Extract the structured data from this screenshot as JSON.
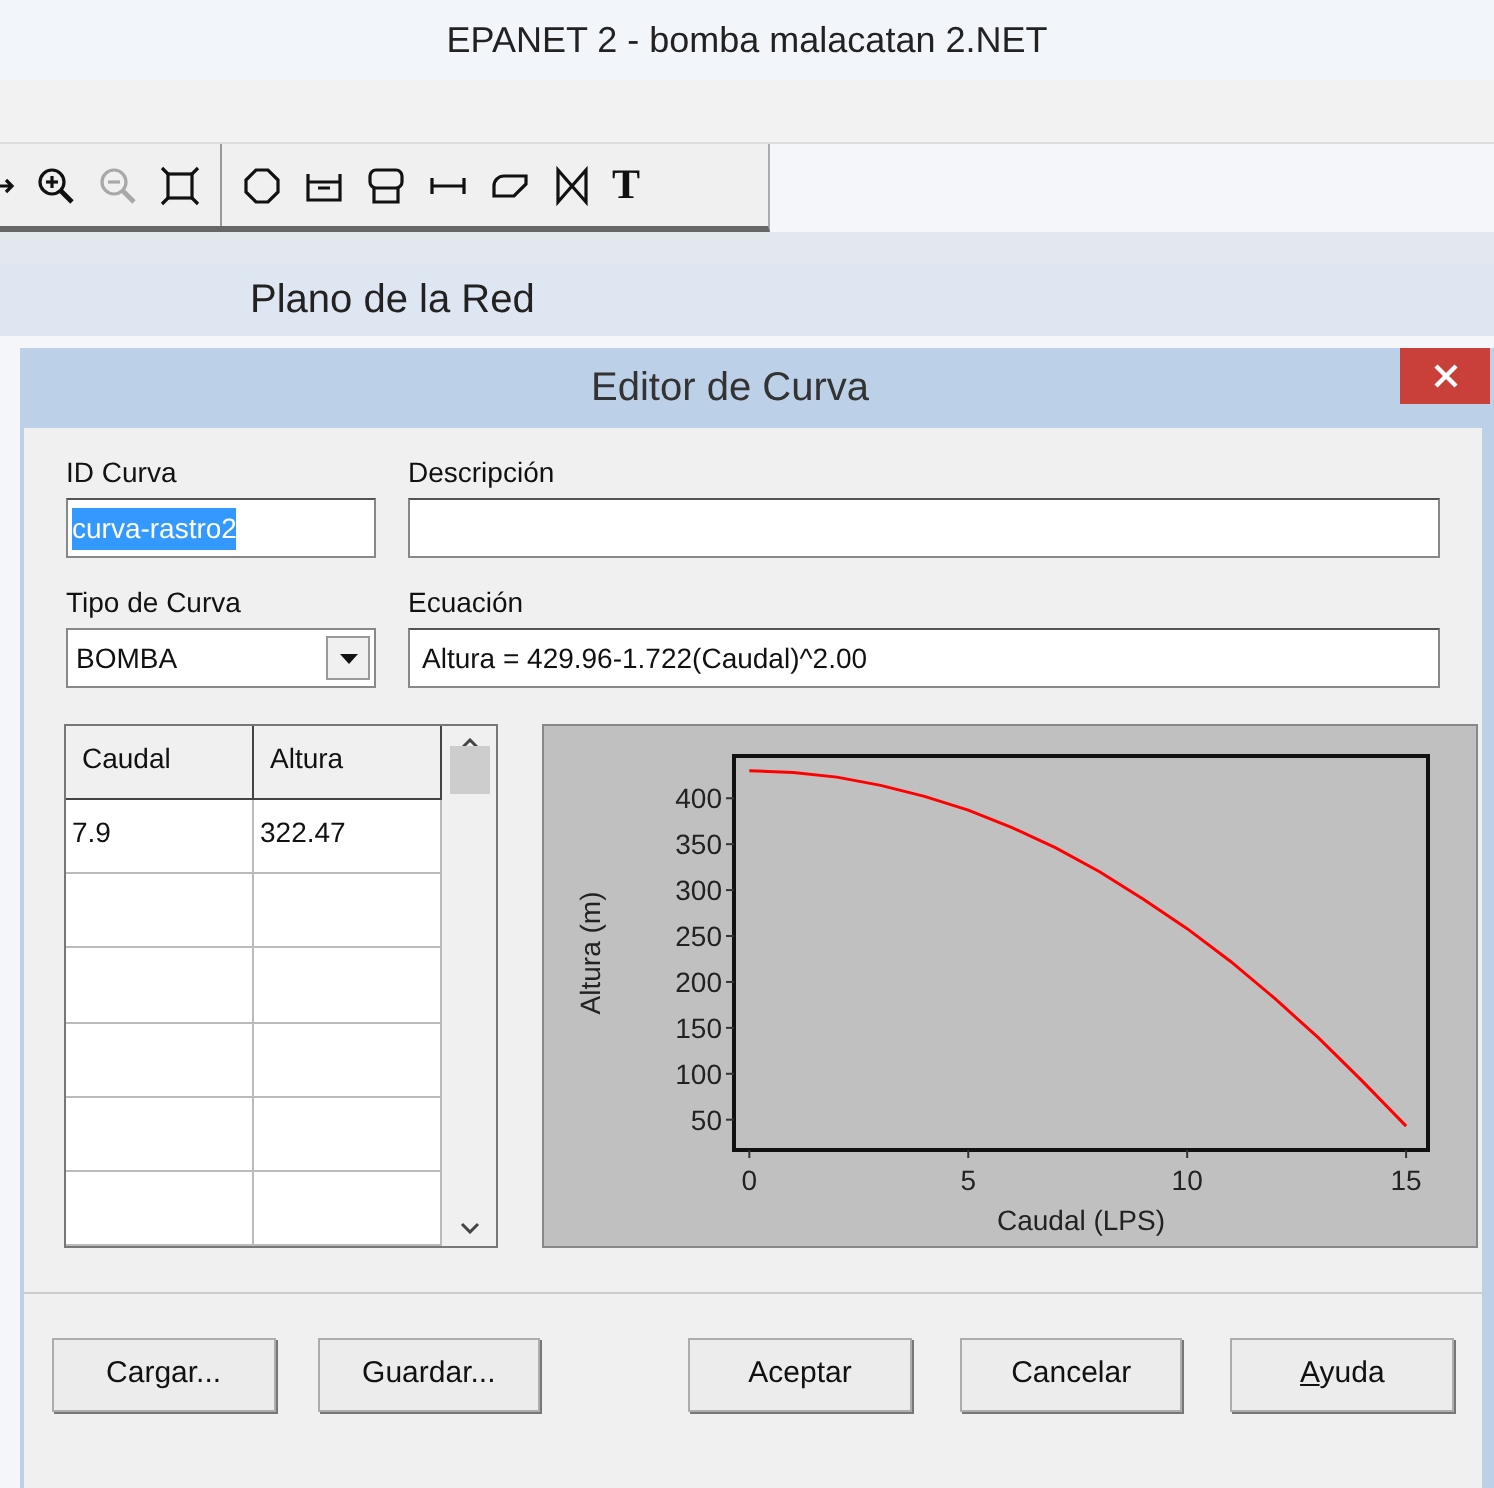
{
  "window": {
    "title": "EPANET 2 - bomba malacatan 2.NET"
  },
  "toolbar_groups": [
    [
      {
        "kind": "arrow",
        "disabled": false
      },
      {
        "kind": "zoom-in",
        "disabled": false
      },
      {
        "kind": "zoom-out",
        "disabled": true
      },
      {
        "kind": "full-extent",
        "disabled": false
      }
    ],
    [
      {
        "kind": "junction",
        "disabled": false
      },
      {
        "kind": "reservoir",
        "disabled": false
      },
      {
        "kind": "tank",
        "disabled": false
      },
      {
        "kind": "pipe",
        "disabled": false
      },
      {
        "kind": "pump",
        "disabled": false
      },
      {
        "kind": "valve",
        "disabled": false
      },
      {
        "kind": "text",
        "label": "T",
        "disabled": false
      }
    ]
  ],
  "map_window": {
    "title": "Plano de la Red"
  },
  "dialog": {
    "title": "Editor de Curva",
    "id_label": "ID Curva",
    "id_value": "curva-rastro2",
    "id_text_selected": true,
    "description_label": "Descripción",
    "type_label": "Tipo de Curva",
    "type_value": "BOMBA",
    "equation_label": "Ecuación",
    "equation_value": "Altura = 429.96-1.722(Caudal)^2.00",
    "table": {
      "columns": [
        "Caudal",
        "Altura"
      ],
      "rows": [
        [
          "7.9",
          "322.47"
        ],
        [
          "",
          ""
        ],
        [
          "",
          ""
        ],
        [
          "",
          ""
        ],
        [
          "",
          ""
        ],
        [
          "",
          ""
        ]
      ]
    },
    "chart_data": {
      "type": "line",
      "xlabel": "Caudal (LPS)",
      "ylabel": "Altura (m)",
      "x": [
        0,
        1,
        2,
        3,
        4,
        5,
        6,
        7,
        8,
        9,
        10,
        11,
        12,
        13,
        14,
        15
      ],
      "series": [
        {
          "color": "#ff0000",
          "values": [
            430,
            428,
            423,
            414,
            402,
            387,
            368,
            346,
            320,
            290,
            258,
            222,
            182,
            139,
            92,
            43
          ]
        }
      ],
      "xlim": [
        -0.35,
        15.5
      ],
      "ylim": [
        17,
        446
      ],
      "xticks": [
        0,
        5,
        10,
        15
      ],
      "yticks": [
        50,
        100,
        150,
        200,
        250,
        300,
        350,
        400
      ]
    },
    "buttons": [
      {
        "label": "Cargar...",
        "underline_first": false
      },
      {
        "label": "Guardar...",
        "underline_first": false
      },
      {
        "label": "Aceptar",
        "underline_first": false
      },
      {
        "label": "Cancelar",
        "underline_first": false
      },
      {
        "label": "Ayuda",
        "underline_first": true
      }
    ]
  }
}
